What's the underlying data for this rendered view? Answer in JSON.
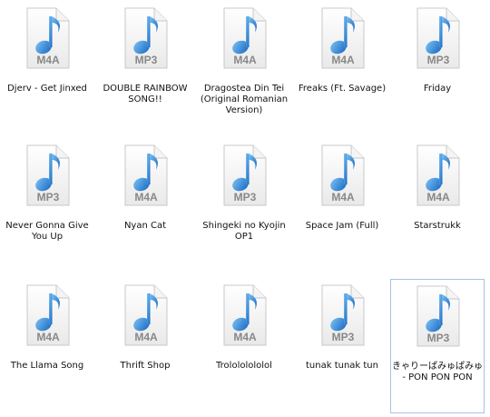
{
  "files": [
    {
      "name": "Djerv - Get Jinxed",
      "ext": "M4A"
    },
    {
      "name": "DOUBLE RAINBOW SONG!!",
      "ext": "MP3"
    },
    {
      "name": "Dragostea Din Tei (Original Romanian Version)",
      "ext": "M4A"
    },
    {
      "name": "Freaks (Ft. Savage)",
      "ext": "M4A"
    },
    {
      "name": "Friday",
      "ext": "MP3"
    },
    {
      "name": "Never Gonna Give You Up",
      "ext": "MP3"
    },
    {
      "name": "Nyan Cat",
      "ext": "M4A"
    },
    {
      "name": "Shingeki no Kyojin OP1",
      "ext": "MP3"
    },
    {
      "name": "Space Jam (Full)",
      "ext": "M4A"
    },
    {
      "name": "Starstrukk",
      "ext": "M4A"
    },
    {
      "name": "The Llama Song",
      "ext": "M4A"
    },
    {
      "name": "Thrift Shop",
      "ext": "M4A"
    },
    {
      "name": "Trolololololol",
      "ext": "M4A"
    },
    {
      "name": "tunak tunak tun",
      "ext": "MP3"
    },
    {
      "name": "きゃりーぱみゅぱみゅ - PON PON PON",
      "ext": "MP3",
      "selected": true
    }
  ],
  "icon": "music-note-file-icon",
  "colors": {
    "note": "#2f7fd3",
    "selection_border": "#a9c2e6"
  }
}
